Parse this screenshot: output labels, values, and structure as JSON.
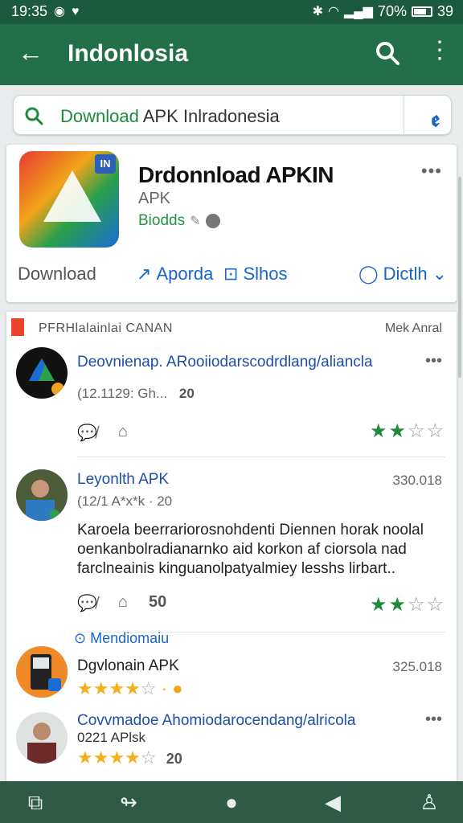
{
  "status": {
    "time": "19:35",
    "battery": "70%",
    "extra": "39"
  },
  "appbar": {
    "title": "Indonlosia"
  },
  "search": {
    "query_highlight": "Download",
    "query_rest": " APK Inlradonesia"
  },
  "app": {
    "name": "Drdonnload APKIN",
    "subtitle": "APK",
    "developer": "Biodds",
    "actions": {
      "download": "Download",
      "share": "Aporda",
      "show": "Slhos",
      "more": "Dictlh"
    }
  },
  "reviews": {
    "header_label": "PFRHlalainlai CANAN",
    "sort_label": "Mek Anral",
    "items": [
      {
        "name": "Deovnienap. ARooiiodarscodrdlang/aliancla",
        "meta": "(12.1129: Gh...",
        "count_badge": "20",
        "rating": 2
      },
      {
        "name": "Leyonlth APK",
        "meta": "(12/1 A*x*k · 20",
        "count": "330.018",
        "text": "Karoela beerrariorosnohdenti Diennen horak noolal oenkanbolradianarnko aid korkon af ciorsola nad farclneainis kinguanolpatyalmiey lesshs lirbart..",
        "likes": "50",
        "rating": 2
      },
      {
        "mention": "Mendiomaiu",
        "name": "Dgvlonain APK",
        "count": "325.018",
        "rating": 4
      },
      {
        "name": "Covvmadoe Ahomiodarocendang/alricola",
        "meta": "0221 APlsk",
        "count_badge": "20",
        "rating": 4
      }
    ]
  },
  "colors": {
    "appbar": "#226f4a",
    "accent_green": "#1e8a3a",
    "link_blue": "#1f4fa8"
  }
}
